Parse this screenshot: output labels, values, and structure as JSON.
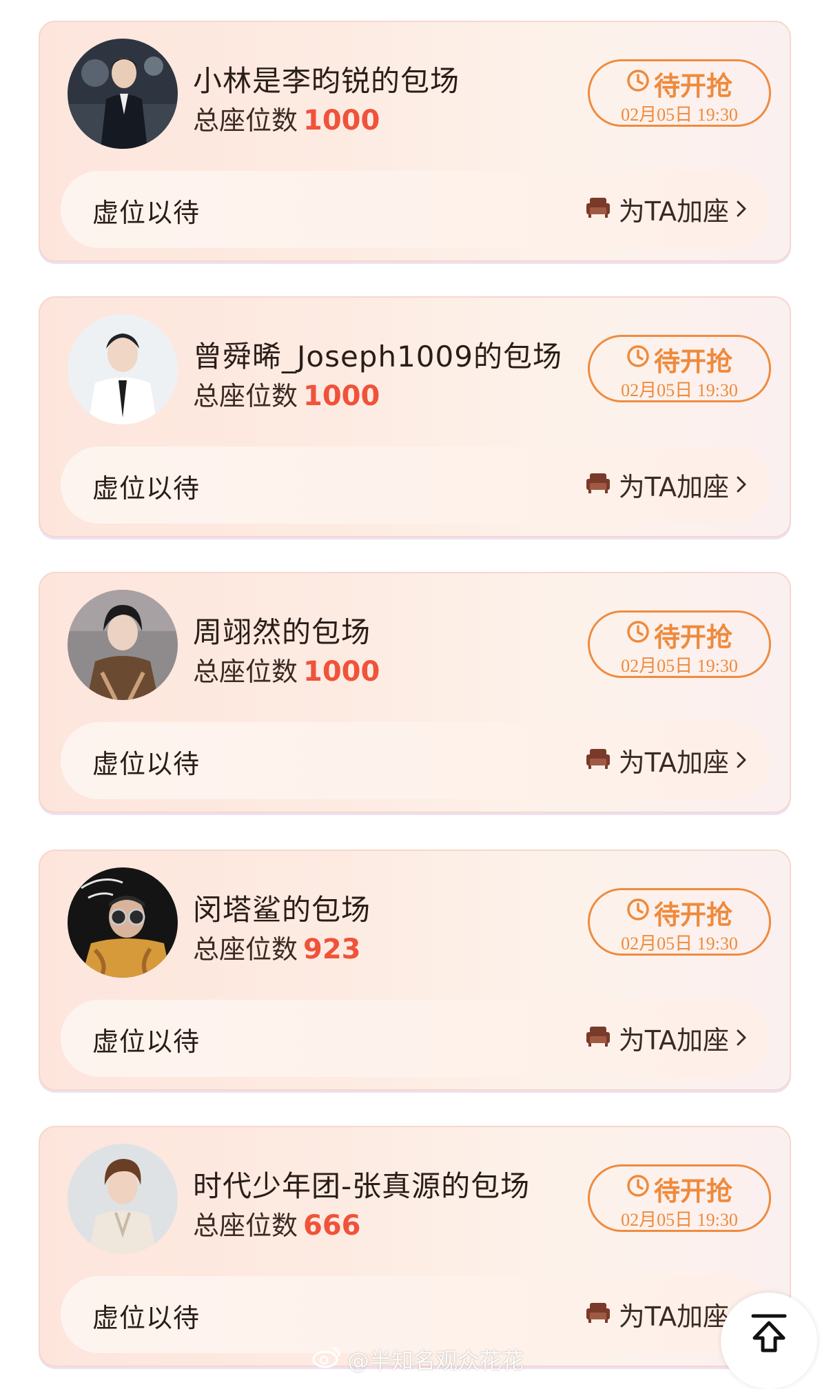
{
  "cards": [
    {
      "title": "小林是李昀锐的包场",
      "seats_label": "总座位数",
      "seats_value": "1000",
      "status_label": "待开抢",
      "status_time": "02月05日 19:30",
      "waiting_label": "虚位以待",
      "add_seat_label": "为TA加座"
    },
    {
      "title": "曾舜晞_Joseph1009的包场",
      "seats_label": "总座位数",
      "seats_value": "1000",
      "status_label": "待开抢",
      "status_time": "02月05日 19:30",
      "waiting_label": "虚位以待",
      "add_seat_label": "为TA加座"
    },
    {
      "title": "周翊然的包场",
      "seats_label": "总座位数",
      "seats_value": "1000",
      "status_label": "待开抢",
      "status_time": "02月05日 19:30",
      "waiting_label": "虚位以待",
      "add_seat_label": "为TA加座"
    },
    {
      "title": "闵塔鲨的包场",
      "seats_label": "总座位数",
      "seats_value": "923",
      "status_label": "待开抢",
      "status_time": "02月05日 19:30",
      "waiting_label": "虚位以待",
      "add_seat_label": "为TA加座"
    },
    {
      "title": "时代少年团-张真源的包场",
      "seats_label": "总座位数",
      "seats_value": "666",
      "status_label": "待开抢",
      "status_time": "02月05日 19:30",
      "waiting_label": "虚位以待",
      "add_seat_label": "为TA加座"
    }
  ],
  "icons": {
    "status": "clock-icon",
    "add_seat": "sofa-icon",
    "add_seat_arrow": "chevron-right-icon",
    "scroll_top": "back-to-top-icon",
    "watermark": "weibo-logo-icon"
  },
  "colors": {
    "accent_orange": "#ee8a3c",
    "seat_count_red": "#f0523a",
    "card_background": "#fde5dc",
    "sofa_brown": "#7a3a2a"
  },
  "watermark": {
    "text": "@半知名观众花花"
  }
}
